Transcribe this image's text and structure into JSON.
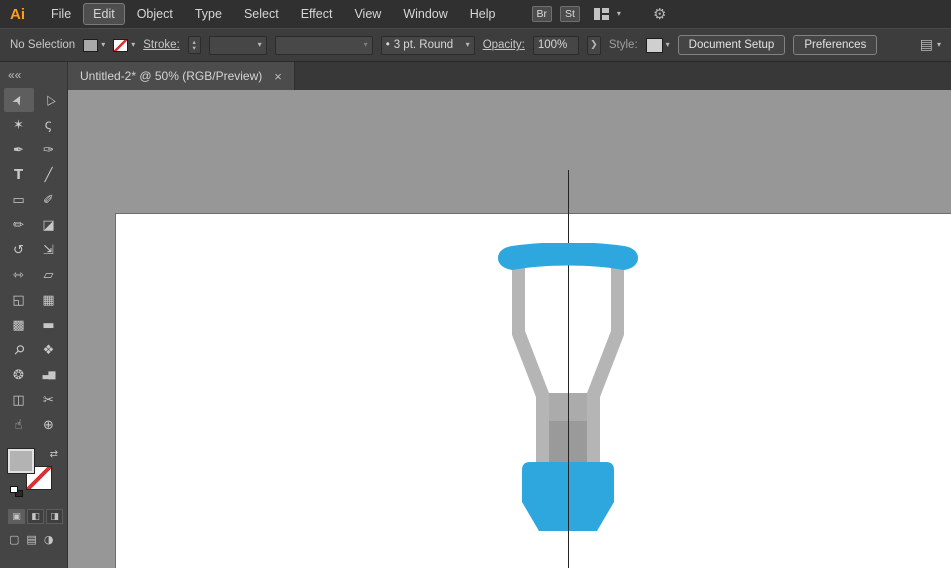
{
  "app": {
    "logo": "Ai"
  },
  "ui": {
    "chevron_down": "▾",
    "stepper_up": "▴",
    "stepper_down": "▾"
  },
  "menubar": {
    "items": [
      {
        "label": "File"
      },
      {
        "label": "Edit",
        "active": true
      },
      {
        "label": "Object"
      },
      {
        "label": "Type"
      },
      {
        "label": "Select"
      },
      {
        "label": "Effect"
      },
      {
        "label": "View"
      },
      {
        "label": "Window"
      },
      {
        "label": "Help"
      }
    ],
    "bridge_badge": "Br",
    "stock_badge": "St",
    "gear_glyph": "⚙"
  },
  "controlbar": {
    "selection_status": "No Selection",
    "stroke_label": "Stroke:",
    "brush_bullet": "•",
    "brush_name": "3 pt. Round",
    "opacity_label": "Opacity:",
    "opacity_value": "100%",
    "opacity_chevron": "❯",
    "style_label": "Style:",
    "document_setup_label": "Document Setup",
    "preferences_label": "Preferences",
    "panel_icon_glyph": "▤"
  },
  "tab": {
    "title": "Untitled-2* @ 50% (RGB/Preview)",
    "close_glyph": "×"
  },
  "toolbar": {
    "collapse_glyph": "««",
    "swap_glyph": "⇄",
    "tools": [
      {
        "name": "selection-tool",
        "glyph": "➤",
        "active": true
      },
      {
        "name": "direct-selection-tool",
        "glyph": "▷"
      },
      {
        "name": "magic-wand-tool",
        "glyph": "✶"
      },
      {
        "name": "lasso-tool",
        "glyph": "ς"
      },
      {
        "name": "pen-tool",
        "glyph": "✒"
      },
      {
        "name": "curvature-tool",
        "glyph": "✑"
      },
      {
        "name": "type-tool",
        "glyph": "T"
      },
      {
        "name": "line-segment-tool",
        "glyph": "╱"
      },
      {
        "name": "rectangle-tool",
        "glyph": "▭"
      },
      {
        "name": "paintbrush-tool",
        "glyph": "✐"
      },
      {
        "name": "pencil-tool",
        "glyph": "✏"
      },
      {
        "name": "eraser-tool",
        "glyph": "◪"
      },
      {
        "name": "rotate-tool",
        "glyph": "↺"
      },
      {
        "name": "scale-tool",
        "glyph": "⇲"
      },
      {
        "name": "width-tool",
        "glyph": "⇿"
      },
      {
        "name": "free-transform-tool",
        "glyph": "▱"
      },
      {
        "name": "shape-builder-tool",
        "glyph": "◱"
      },
      {
        "name": "perspective-grid-tool",
        "glyph": "▦"
      },
      {
        "name": "mesh-tool",
        "glyph": "▩"
      },
      {
        "name": "gradient-tool",
        "glyph": "▬"
      },
      {
        "name": "eyedropper-tool",
        "glyph": "⚲"
      },
      {
        "name": "blend-tool",
        "glyph": "❖"
      },
      {
        "name": "symbol-sprayer-tool",
        "glyph": "❂"
      },
      {
        "name": "column-graph-tool",
        "glyph": "▃▆"
      },
      {
        "name": "artboard-tool",
        "glyph": "◫"
      },
      {
        "name": "slice-tool",
        "glyph": "✂"
      },
      {
        "name": "hand-tool",
        "glyph": "☝"
      },
      {
        "name": "zoom-tool",
        "glyph": "⊕"
      }
    ],
    "draw_modes": [
      {
        "name": "draw-normal-mode",
        "glyph": "▣",
        "active": true
      },
      {
        "name": "draw-behind-mode",
        "glyph": "◧"
      },
      {
        "name": "draw-inside-mode",
        "glyph": "◨"
      }
    ],
    "screen_buttons": [
      {
        "name": "screen-mode-icon",
        "glyph": "▢"
      },
      {
        "name": "presentation-mode-icon",
        "glyph": "▤"
      },
      {
        "name": "color-mode-icon",
        "glyph": "◑"
      }
    ]
  },
  "artwork": {
    "blue": "#2EA7DE",
    "leg_gray": "#B5B5B5",
    "shaft_gray": "#ABABAB",
    "shaft_dark_gray": "#9A9A9A",
    "line_color": "#232323"
  }
}
